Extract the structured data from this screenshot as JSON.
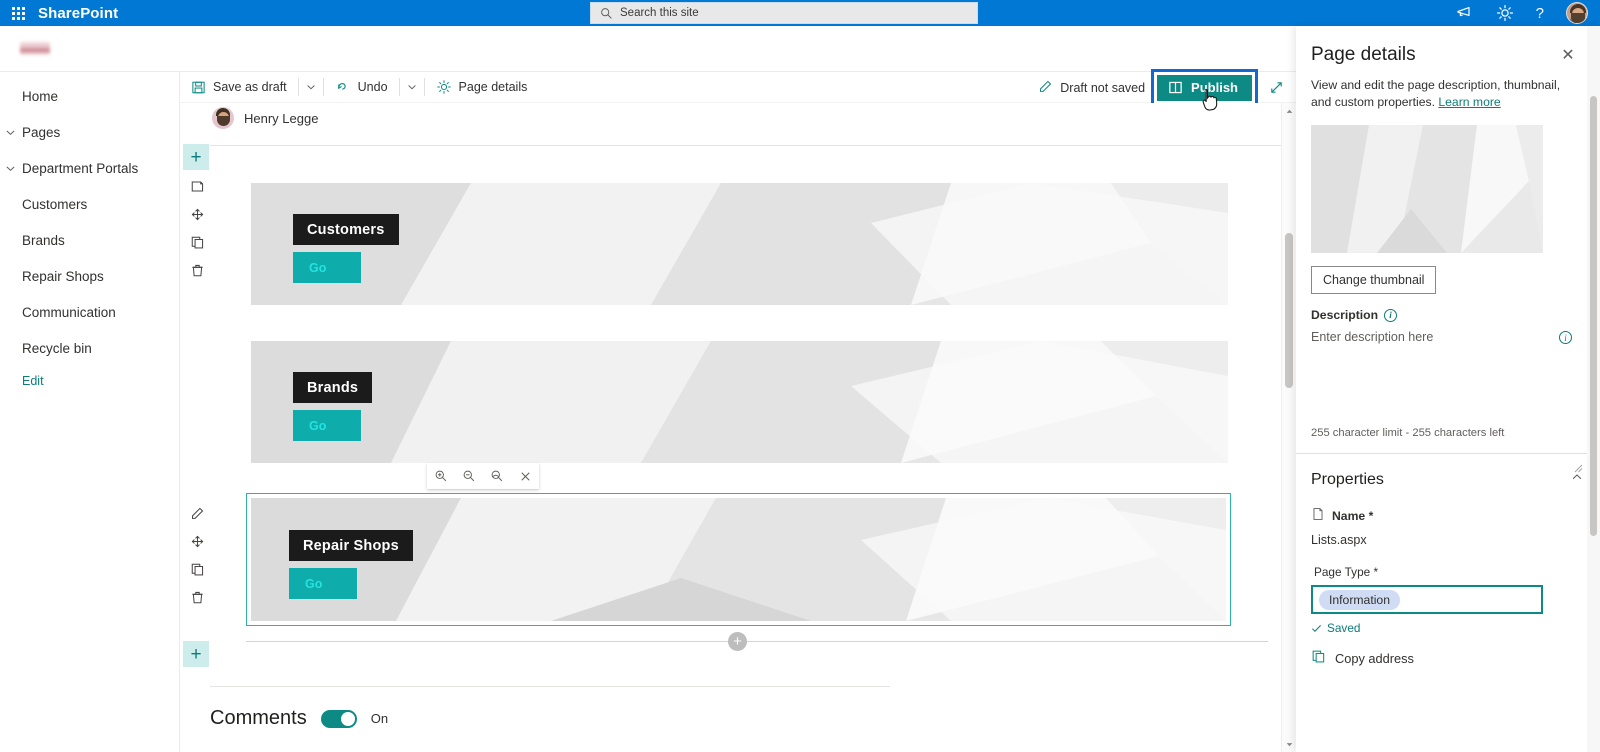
{
  "suite": {
    "waffle_name": "app-launcher-icon",
    "brand": "SharePoint",
    "search_placeholder": "Search this site",
    "icons": [
      "megaphone-icon",
      "gear-icon",
      "help-icon"
    ],
    "help_glyph": "?",
    "accent": "#0078d4"
  },
  "sidebar": {
    "items": [
      {
        "label": "Home",
        "chevron": false
      },
      {
        "label": "Pages",
        "chevron": true
      },
      {
        "label": "Department Portals",
        "chevron": true
      },
      {
        "label": "Customers",
        "chevron": false
      },
      {
        "label": "Brands",
        "chevron": false
      },
      {
        "label": "Repair Shops",
        "chevron": false
      },
      {
        "label": "Communication",
        "chevron": false
      },
      {
        "label": "Recycle bin",
        "chevron": false
      }
    ],
    "edit_label": "Edit",
    "edit_color": "#0d7c78"
  },
  "commandbar": {
    "save_label": "Save as draft",
    "undo_label": "Undo",
    "page_details_label": "Page details",
    "draft_status": "Draft not saved",
    "publish_label": "Publish",
    "publish_color": "#0d8a84",
    "focus_ring_color": "#1267d1"
  },
  "canvas": {
    "author_name": "Henry Legge",
    "cards": [
      {
        "title": "Customers",
        "button": "Go",
        "selected": false
      },
      {
        "title": "Brands",
        "button": "Go",
        "selected": false
      },
      {
        "title": "Repair Shops",
        "button": "Go",
        "selected": true
      }
    ],
    "card_label_bg": "#1b1b1b",
    "card_go_bg": "#0eacab",
    "card_go_text_color": "#23e3e0",
    "selection_border_color": "#2bb3ad",
    "zoom_toolbar": [
      "zoom-in-icon",
      "zoom-out-icon",
      "zoom-reset-icon",
      "close-icon"
    ],
    "section_toolbar_top": [
      "add-section-icon",
      "edit-section-icon",
      "move-section-icon",
      "duplicate-section-icon",
      "delete-section-icon"
    ],
    "section_toolbar_selected": [
      "edit-webpart-icon",
      "move-webpart-icon",
      "duplicate-webpart-icon",
      "delete-webpart-icon"
    ],
    "add_section_glyph": "+",
    "comments": {
      "title": "Comments",
      "state": "On",
      "toggle_on": true,
      "toggle_color": "#0d8a84"
    }
  },
  "panel": {
    "title": "Page details",
    "close_glyph": "✕",
    "description_intro": "View and edit the page description, thumbnail, and custom properties.",
    "learn_more": "Learn more",
    "change_thumbnail_label": "Change thumbnail",
    "description_label": "Description",
    "description_value": "",
    "description_placeholder": "Enter description here",
    "char_limit_text": "255 character limit - 255 characters left",
    "properties_title": "Properties",
    "name_label": "Name *",
    "name_value": "Lists.aspx",
    "page_type_label": "Page Type *",
    "page_type_value": "Information",
    "page_type_tag_bg": "#cfdcf3",
    "page_type_border": "#0d8a84",
    "saved_label": "Saved",
    "saved_color": "#0d7c78",
    "copy_address_label": "Copy address"
  }
}
